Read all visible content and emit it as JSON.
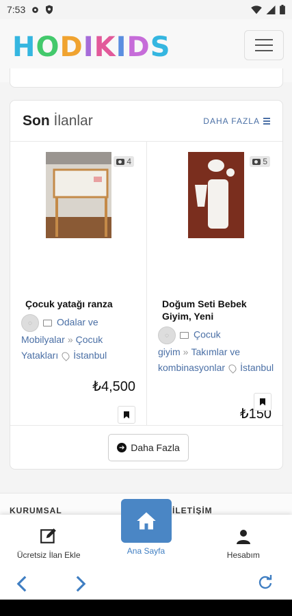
{
  "status_bar": {
    "time": "7:53"
  },
  "header": {
    "logo_text": "HODIKIDS"
  },
  "section": {
    "title_bold": "Son",
    "title_rest": "İlanlar",
    "more_label": "DAHA FAZLA",
    "listings": [
      {
        "title": "Çocuk yatağı ranza",
        "photo_count": "4",
        "category": "Odalar ve Mobilyalar",
        "subcategory": "Çocuk Yatakları",
        "location": "İstanbul",
        "price": "₺4,500"
      },
      {
        "title": "Doğum Seti Bebek Giyim, Yeni",
        "photo_count": "5",
        "category": "Çocuk giyim",
        "subcategory": "Takımlar ve kombinasyonlar",
        "location": "İstanbul",
        "price": "₺150"
      }
    ],
    "daha_button": "Daha Fazla"
  },
  "footer": {
    "col1": "KURUMSAL",
    "col2": "İLETİŞİM"
  },
  "bottom_nav": {
    "add": "Ücretsiz İlan Ekle",
    "home": "Ana Sayfa",
    "account": "Hesabım"
  },
  "colors": {
    "accent": "#4a86c5",
    "link": "#4a6fa5"
  }
}
